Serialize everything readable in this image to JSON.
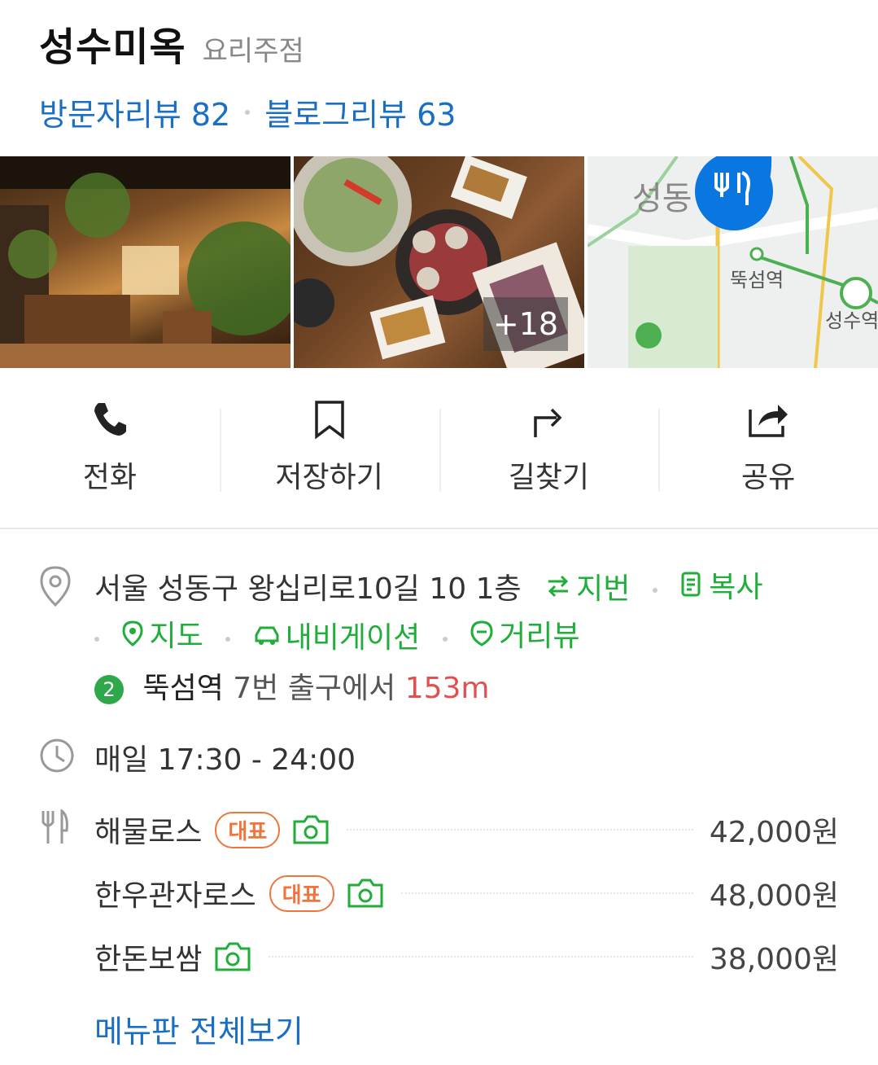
{
  "place": {
    "name": "성수미옥",
    "category": "요리주점",
    "visitor_reviews": "방문자리뷰 82",
    "blog_reviews": "블로그리뷰 63"
  },
  "photos": {
    "more_count": "+18"
  },
  "map": {
    "label_sd": "성동",
    "station": "뚝섬역",
    "station2": "성수역"
  },
  "actions": [
    {
      "label": "전화",
      "icon": "phone-icon"
    },
    {
      "label": "저장하기",
      "icon": "bookmark-icon"
    },
    {
      "label": "길찾기",
      "icon": "directions-icon"
    },
    {
      "label": "공유",
      "icon": "share-icon"
    }
  ],
  "address": {
    "text": "서울 성동구 왕십리로10길 10 1층",
    "lot_number": "지번",
    "copy": "복사",
    "map": "지도",
    "navigation": "내비게이션",
    "street_view": "거리뷰"
  },
  "subway": {
    "line": "2",
    "station": "뚝섬역",
    "exit": "7번 출구에서",
    "distance": "153m",
    "line_color": "#2ea84a"
  },
  "hours": "매일 17:30 - 24:00",
  "menu": [
    {
      "name": "해물로스",
      "tag": "대표",
      "price": "42,000원"
    },
    {
      "name": "한우관자로스",
      "tag": "대표",
      "price": "48,000원"
    },
    {
      "name": "한돈보쌈",
      "tag": "",
      "price": "38,000원"
    }
  ],
  "menu_all": "메뉴판 전체보기",
  "colors": {
    "link_blue": "#1a6fc4",
    "green": "#1fae3a",
    "orange": "#f0743d",
    "red": "#e05050"
  }
}
